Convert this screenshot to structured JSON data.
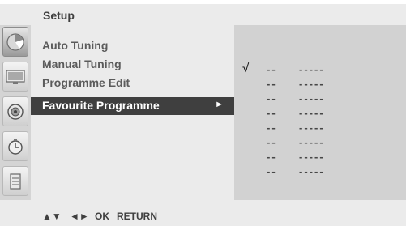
{
  "header": {
    "title": "Setup"
  },
  "sidebar": {
    "icons": [
      {
        "name": "setup-icon",
        "active": true
      },
      {
        "name": "picture-icon",
        "active": false
      },
      {
        "name": "audio-icon",
        "active": false
      },
      {
        "name": "time-icon",
        "active": false
      },
      {
        "name": "option-icon",
        "active": false
      }
    ]
  },
  "menu": {
    "items": [
      {
        "label": "Auto Tuning",
        "selected": false
      },
      {
        "label": "Manual Tuning",
        "selected": false
      },
      {
        "label": "Programme Edit",
        "selected": false
      },
      {
        "label": "Favourite Programme",
        "selected": true,
        "arrow": "►"
      }
    ]
  },
  "favourites": {
    "checked_index": 0,
    "check_mark": "√",
    "rows": [
      {
        "number": "--",
        "name": "-----"
      },
      {
        "number": "--",
        "name": "-----"
      },
      {
        "number": "--",
        "name": "-----"
      },
      {
        "number": "--",
        "name": "-----"
      },
      {
        "number": "--",
        "name": "-----"
      },
      {
        "number": "--",
        "name": "-----"
      },
      {
        "number": "--",
        "name": "-----"
      },
      {
        "number": "--",
        "name": "-----"
      }
    ]
  },
  "footer": {
    "up_down": "▲▼",
    "left_right": "◄►",
    "ok": "OK",
    "return": "RETURN"
  },
  "colors": {
    "selected_bg": "#3f3f3f",
    "menu_bg": "#ebebeb",
    "panel_bg": "#d2d2d2"
  }
}
